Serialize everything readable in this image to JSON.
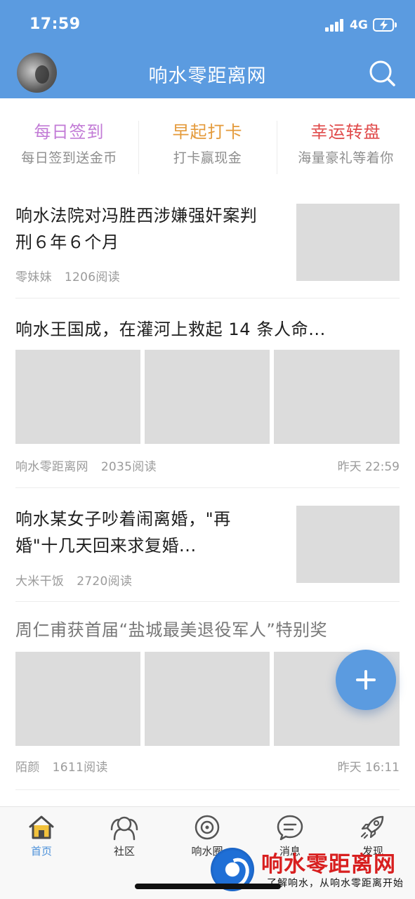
{
  "status_bar": {
    "time": "17:59",
    "network": "4G"
  },
  "header": {
    "title": "响水零距离网"
  },
  "quick_entries": [
    {
      "title": "每日签到",
      "subtitle": "每日签到送金币",
      "color": "#c27bd6"
    },
    {
      "title": "早起打卡",
      "subtitle": "打卡赢现金",
      "color": "#e49a3a"
    },
    {
      "title": "幸运转盘",
      "subtitle": "海量豪礼等着你",
      "color": "#e04b4b"
    }
  ],
  "feed": [
    {
      "title_line1": "响水法院对冯胜西涉嫌强奸案判",
      "title_line2": "刑６年６个月",
      "author": "零妹妹",
      "reads": "1206阅读"
    },
    {
      "title": "响水王国成，在灌河上救起 14 条人命...",
      "author": "响水零距离网",
      "reads": "2035阅读",
      "time": "昨天 22:59"
    },
    {
      "title_line1": "响水某女子吵着闹离婚，\"再",
      "title_line2": "婚\"十几天回来求复婚...",
      "author": "大米干饭",
      "reads": "2720阅读"
    },
    {
      "title": "周仁甫获首届“盐城最美退役军人”特别奖",
      "author": "陌颜",
      "reads": "1611阅读",
      "time": "昨天 16:11"
    }
  ],
  "tabs": [
    {
      "label": "首页",
      "icon": "home-icon",
      "active": true
    },
    {
      "label": "社区",
      "icon": "community-icon"
    },
    {
      "label": "响水圈",
      "icon": "circle-icon"
    },
    {
      "label": "消息",
      "icon": "message-icon"
    },
    {
      "label": "发现",
      "icon": "rocket-icon"
    }
  ],
  "watermark": {
    "name": "响水零距离网",
    "slogan": "了解响水，从响水零距离开始"
  },
  "colors": {
    "primary": "#5b9be0",
    "thumb": "#dcdcdc"
  }
}
